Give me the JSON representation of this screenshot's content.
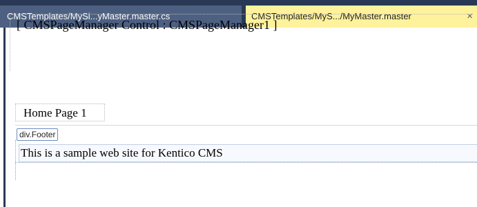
{
  "tabs": [
    {
      "label": "CMSTemplates/MySi...yMaster.master.cs",
      "active": false
    },
    {
      "label": "CMSTemplates/MyS.../MyMaster.master",
      "active": true
    }
  ],
  "close_icon": "×",
  "designer": {
    "page_manager_label": "[ CMSPageManager Control : CMSPageManager1 ]",
    "home_text": "Home Page 1",
    "footer_tag": "div.Footer",
    "footer_text": "This is a sample web site for Kentico CMS"
  },
  "colors": {
    "tabbar_bg": "#293955",
    "active_tab_bg": "#fff29d",
    "inactive_tab_bg": "#4d6082"
  }
}
